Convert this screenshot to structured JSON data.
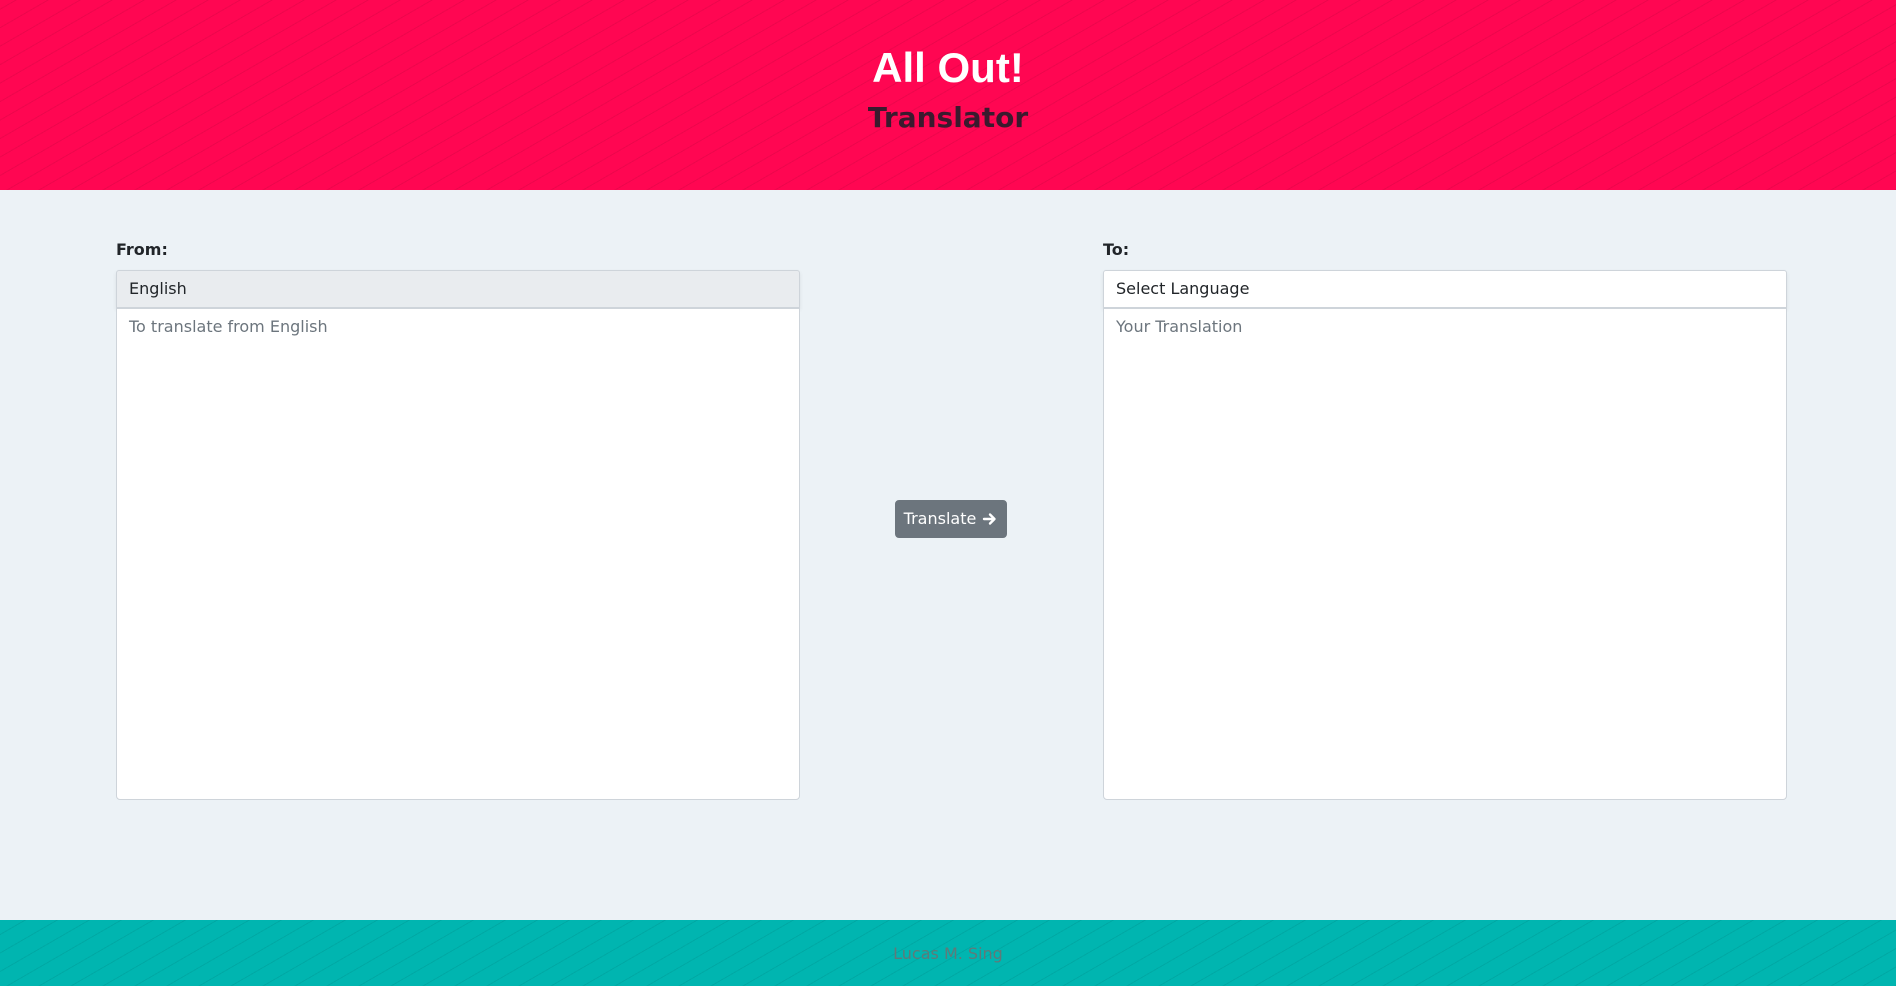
{
  "header": {
    "title": "All Out!",
    "subtitle": "Translator",
    "background_color": "#ff0652"
  },
  "from_panel": {
    "label": "From:",
    "language": "English",
    "placeholder": "To translate from English",
    "value": ""
  },
  "to_panel": {
    "label": "To:",
    "language": "Select Language",
    "placeholder": "Your Translation",
    "value": ""
  },
  "translate_button": {
    "label": "Translate",
    "icon": "arrow-right-icon",
    "color": "#6c757d"
  },
  "footer": {
    "credit": "Lucas M. Sing",
    "background_color": "#00b5b0"
  }
}
